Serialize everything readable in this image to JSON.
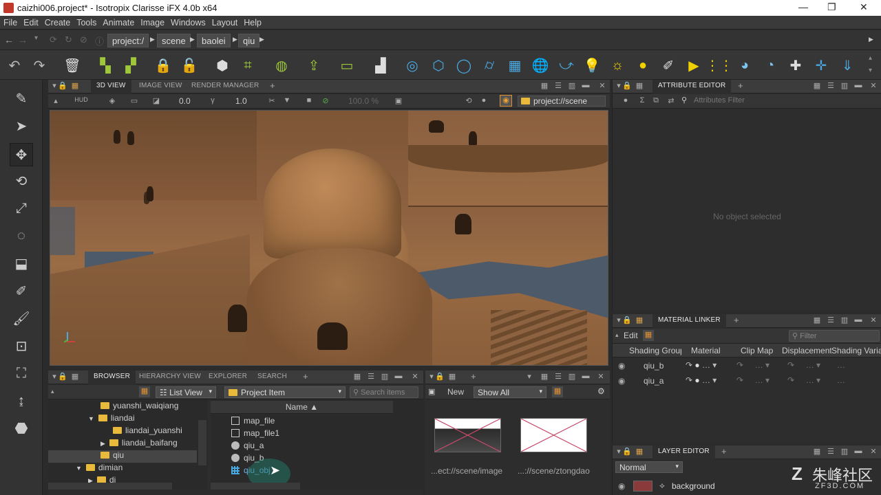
{
  "window": {
    "title": "caizhi006.project* - Isotropix Clarisse iFX 4.0b x64",
    "min": "—",
    "max": "❐",
    "close": "✕"
  },
  "menu": [
    "File",
    "Edit",
    "Create",
    "Tools",
    "Animate",
    "Image",
    "Windows",
    "Layout",
    "Help"
  ],
  "path": {
    "crumbs": [
      "project:/",
      "scene",
      "baolei",
      "qiu"
    ]
  },
  "viewport_panel": {
    "tabs": [
      "3D VIEW",
      "IMAGE VIEW",
      "RENDER MANAGER"
    ],
    "plus": "+",
    "hud": "HUD",
    "value1": "0.0",
    "value2": "1.0",
    "zoom": "100.0 %",
    "context": "project://scene"
  },
  "attribute_editor": {
    "tab": "ATTRIBUTE EDITOR",
    "plus": "+",
    "filter_placeholder": "Attributes Filter",
    "empty": "No object selected"
  },
  "material_linker": {
    "tab": "MATERIAL LINKER",
    "plus": "+",
    "edit": "Edit",
    "filter_placeholder": "Filter",
    "columns": [
      "Shading Group",
      "Material",
      "Clip Map",
      "Displacement",
      "Shading Variab"
    ],
    "rows": [
      {
        "name": "qiu_b"
      },
      {
        "name": "qiu_a"
      }
    ]
  },
  "layer_editor": {
    "tab": "LAYER EDITOR",
    "plus": "+",
    "mode": "Normal",
    "layer": "background"
  },
  "browser": {
    "tabs": [
      "BROWSER",
      "HIERARCHY VIEW",
      "EXPLORER",
      "SEARCH"
    ],
    "plus": "+",
    "view": "List View",
    "filter": "Project Item",
    "search_placeholder": "Search items",
    "tree": [
      {
        "label": "yuanshi_waiqiang",
        "indent": 1
      },
      {
        "label": "liandai",
        "indent": 1,
        "open": true
      },
      {
        "label": "liandai_yuanshi",
        "indent": 2
      },
      {
        "label": "liandai_baifang",
        "indent": 2,
        "collapsed": true
      },
      {
        "label": "qiu",
        "indent": 1,
        "selected": true
      },
      {
        "label": "dimian",
        "indent": 0,
        "open": true
      },
      {
        "label": "di",
        "indent": 1
      }
    ],
    "col_name": "Name ▲",
    "items": [
      {
        "label": "map_file",
        "icon": "map"
      },
      {
        "label": "map_file1",
        "icon": "map"
      },
      {
        "label": "qiu_a",
        "icon": "sphere"
      },
      {
        "label": "qiu_b",
        "icon": "sphere"
      },
      {
        "label": "qiu_obj",
        "icon": "grid"
      }
    ]
  },
  "image_panel": {
    "plus": "+",
    "new": "New",
    "show": "Show All",
    "thumbs": [
      {
        "caption": "...ect://scene/image"
      },
      {
        "caption": "...://scene/ztongdao"
      }
    ]
  },
  "watermark": {
    "text": "朱峰社区",
    "sub": "ZF3D.COM"
  }
}
